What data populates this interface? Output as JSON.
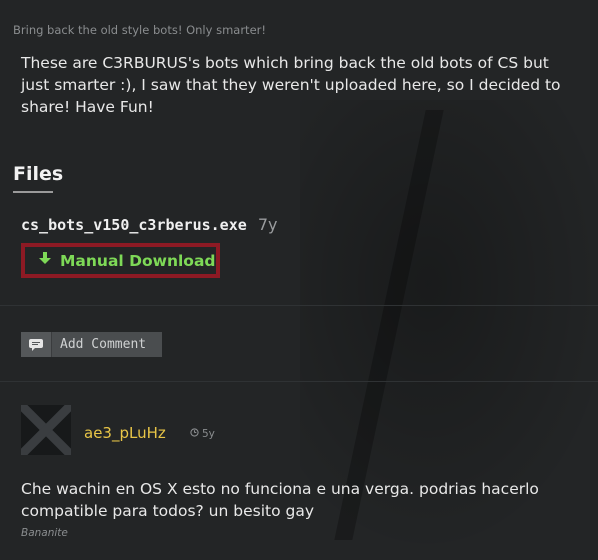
{
  "post": {
    "tagline": "Bring back the old style bots! Only smarter!",
    "description": "These are C3RBURUS's bots which bring back the old bots of CS but just smarter :), I saw that they weren't uploaded here, so I decided to share! Have Fun!"
  },
  "files": {
    "heading": "Files",
    "items": [
      {
        "name": "cs_bots_v150_c3rberus.exe",
        "age": "7y",
        "download_label": "Manual Download",
        "download_icon": "download-arrow-icon"
      }
    ]
  },
  "comments": {
    "add_label": "Add Comment",
    "add_icon": "comment-bubble-icon",
    "items": [
      {
        "username": "ae3_pLuHz",
        "age": "5y",
        "age_icon": "clock-icon",
        "text": "Che wachin en OS X esto no funciona e una verga. podrias hacerlo compatible para todos? un besito gay",
        "signature": "Bananite"
      }
    ]
  },
  "colors": {
    "background": "#232526",
    "download_green": "#7ed957",
    "highlight_border": "#8d1a24",
    "username_yellow": "#e8c547"
  }
}
